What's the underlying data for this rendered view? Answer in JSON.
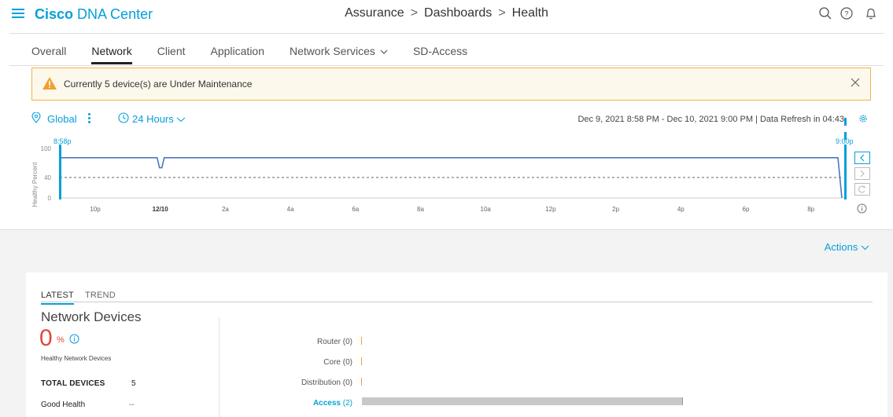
{
  "header": {
    "brand_bold": "Cisco",
    "brand_rest": "DNA Center",
    "breadcrumb": [
      "Assurance",
      "Dashboards",
      "Health"
    ],
    "separator": ">",
    "icons": [
      "search-icon",
      "help-icon",
      "bell-icon"
    ]
  },
  "tabs": [
    {
      "label": "Overall",
      "active": false
    },
    {
      "label": "Network",
      "active": true
    },
    {
      "label": "Client",
      "active": false
    },
    {
      "label": "Application",
      "active": false
    },
    {
      "label": "Network Services",
      "active": false,
      "dropdown": true
    },
    {
      "label": "SD-Access",
      "active": false
    }
  ],
  "alert": {
    "message": "Currently 5 device(s) are Under Maintenance",
    "icon": "warning-icon",
    "color": "#f0b44c"
  },
  "filters": {
    "location": "Global",
    "time_range": "24 Hours",
    "date_range_text": "Dec 9, 2021 8:58 PM - Dec 10, 2021 9:00 PM | Data Refresh in 04:43"
  },
  "timeline": {
    "ylabel": "Healthy Percent",
    "yticks": [
      "100",
      "40",
      "0"
    ],
    "xticks": [
      "10p",
      "12/10",
      "2a",
      "4a",
      "6a",
      "8a",
      "10a",
      "12p",
      "2p",
      "4p",
      "6p",
      "8p"
    ],
    "start_label": "8:58p",
    "end_label": "9:00p",
    "threshold": 40,
    "series_color": "#4a78c2",
    "accent": "#049fd9"
  },
  "actions_label": "Actions",
  "latest": {
    "subtabs": [
      {
        "label": "LATEST",
        "active": true
      },
      {
        "label": "TREND",
        "active": false
      }
    ],
    "title": "Network Devices",
    "percent": "0",
    "percent_unit": "%",
    "healthy_label": "Healthy Network Devices",
    "total_label": "TOTAL DEVICES",
    "total_value": "5",
    "good_label": "Good Health",
    "good_value": "--",
    "categories": [
      {
        "name": "Router",
        "count": "(0)",
        "value": 0,
        "link": false
      },
      {
        "name": "Core",
        "count": "(0)",
        "value": 0,
        "link": false
      },
      {
        "name": "Distribution",
        "count": "(0)",
        "value": 0,
        "link": false
      },
      {
        "name": "Access",
        "count": "(2)",
        "value": 2,
        "link": true
      }
    ]
  },
  "chart_data": {
    "type": "line",
    "ylabel": "Healthy Percent",
    "ylim": [
      0,
      100
    ],
    "yticks": [
      0,
      40,
      100
    ],
    "x": [
      "8:58p",
      "10p",
      "12/10",
      "2a",
      "4a",
      "6a",
      "8a",
      "10a",
      "12p",
      "2p",
      "4p",
      "6p",
      "8p",
      "9:00p"
    ],
    "series": [
      {
        "values": [
          80,
          80,
          80,
          80,
          80,
          80,
          80,
          80,
          80,
          80,
          80,
          80,
          80,
          0
        ]
      }
    ],
    "dips": [
      {
        "at": "12/10",
        "value": 60
      }
    ],
    "threshold_line": 40
  }
}
